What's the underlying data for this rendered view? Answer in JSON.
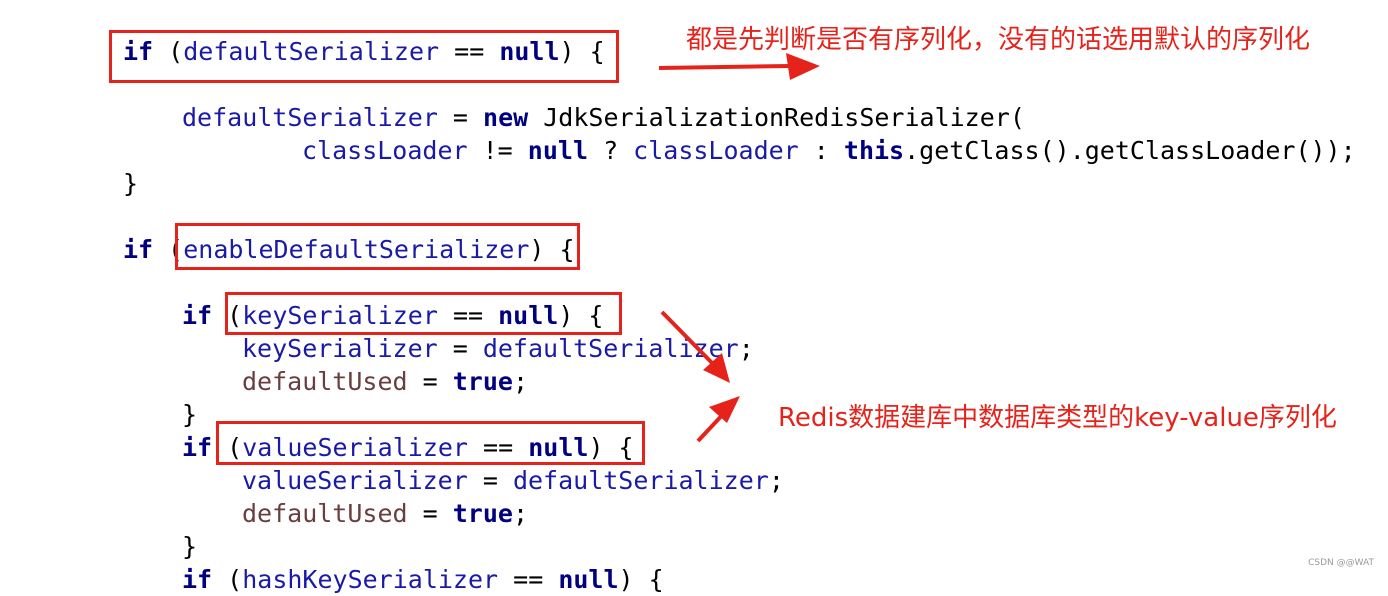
{
  "code": {
    "lines": [
      [
        {
          "t": "kw",
          "v": "if"
        },
        {
          "t": "plain",
          "v": " ("
        },
        {
          "t": "fld",
          "v": "defaultSerializer"
        },
        {
          "t": "plain",
          "v": " == "
        },
        {
          "t": "kw",
          "v": "null"
        },
        {
          "t": "plain",
          "v": ") {"
        }
      ],
      [
        {
          "t": "fld",
          "v": "defaultSerializer"
        },
        {
          "t": "plain",
          "v": " = "
        },
        {
          "t": "kw",
          "v": "new"
        },
        {
          "t": "plain",
          "v": " JdkSerializationRedisSerializer("
        }
      ],
      [
        {
          "t": "fld",
          "v": "classLoader"
        },
        {
          "t": "plain",
          "v": " != "
        },
        {
          "t": "kw",
          "v": "null"
        },
        {
          "t": "plain",
          "v": " ? "
        },
        {
          "t": "fld",
          "v": "classLoader"
        },
        {
          "t": "plain",
          "v": " : "
        },
        {
          "t": "kw",
          "v": "this"
        },
        {
          "t": "plain",
          "v": ".getClass().getClassLoader());"
        }
      ],
      [
        {
          "t": "plain",
          "v": "}"
        }
      ],
      [
        {
          "t": "kw",
          "v": "if"
        },
        {
          "t": "plain",
          "v": " ("
        },
        {
          "t": "fld",
          "v": "enableDefaultSerializer"
        },
        {
          "t": "plain",
          "v": ") {"
        }
      ],
      [
        {
          "t": "kw",
          "v": "if"
        },
        {
          "t": "plain",
          "v": " ("
        },
        {
          "t": "fld",
          "v": "keySerializer"
        },
        {
          "t": "plain",
          "v": " == "
        },
        {
          "t": "kw",
          "v": "null"
        },
        {
          "t": "plain",
          "v": ") {"
        }
      ],
      [
        {
          "t": "fld",
          "v": "keySerializer"
        },
        {
          "t": "plain",
          "v": " = "
        },
        {
          "t": "fld",
          "v": "defaultSerializer"
        },
        {
          "t": "plain",
          "v": ";"
        }
      ],
      [
        {
          "t": "loc",
          "v": "defaultUsed"
        },
        {
          "t": "plain",
          "v": " = "
        },
        {
          "t": "kw",
          "v": "true"
        },
        {
          "t": "plain",
          "v": ";"
        }
      ],
      [
        {
          "t": "plain",
          "v": "}"
        }
      ],
      [
        {
          "t": "kw",
          "v": "if"
        },
        {
          "t": "plain",
          "v": " ("
        },
        {
          "t": "fld",
          "v": "valueSerializer"
        },
        {
          "t": "plain",
          "v": " == "
        },
        {
          "t": "kw",
          "v": "null"
        },
        {
          "t": "plain",
          "v": ") {"
        }
      ],
      [
        {
          "t": "fld",
          "v": "valueSerializer"
        },
        {
          "t": "plain",
          "v": " = "
        },
        {
          "t": "fld",
          "v": "defaultSerializer"
        },
        {
          "t": "plain",
          "v": ";"
        }
      ],
      [
        {
          "t": "loc",
          "v": "defaultUsed"
        },
        {
          "t": "plain",
          "v": " = "
        },
        {
          "t": "kw",
          "v": "true"
        },
        {
          "t": "plain",
          "v": ";"
        }
      ],
      [
        {
          "t": "plain",
          "v": "}"
        }
      ],
      [
        {
          "t": "kw",
          "v": "if"
        },
        {
          "t": "plain",
          "v": " ("
        },
        {
          "t": "fld",
          "v": "hashKeySerializer"
        },
        {
          "t": "plain",
          "v": " == "
        },
        {
          "t": "kw",
          "v": "null"
        },
        {
          "t": "plain",
          "v": ") {"
        }
      ]
    ]
  },
  "annotations": {
    "note_top": "都是先判断是否有序列化，没有的话选用默认的序列化",
    "note_right": "Redis数据建库中数据库类型的key-value序列化"
  },
  "watermark": "CSDN @@WAT",
  "colors": {
    "keyword": "#000080",
    "field": "#1a1aa6",
    "local": "#6a3e3e",
    "annotation": "#e5231b"
  }
}
